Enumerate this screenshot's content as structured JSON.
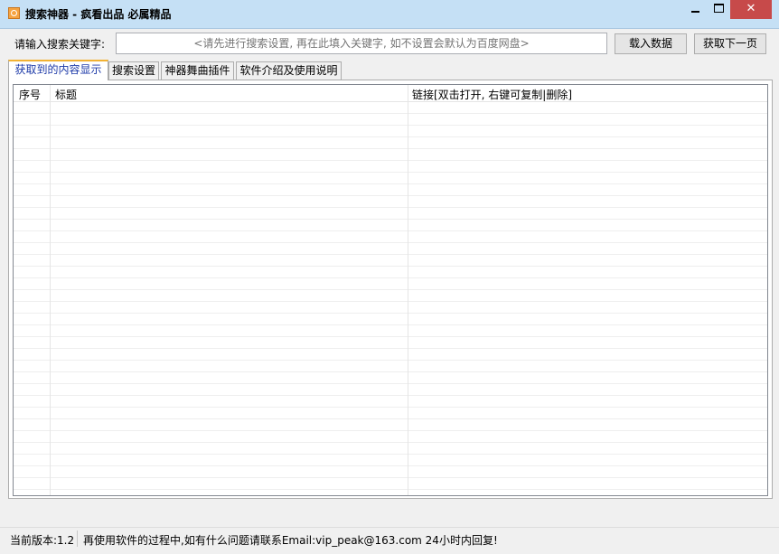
{
  "window": {
    "title": "搜索神器 - 疯看出品 必属精品",
    "icon": "app-icon",
    "controls": {
      "minimize": "minimize-icon",
      "maximize": "maximize-icon",
      "close": "✕"
    }
  },
  "search": {
    "label": "请输入搜索关键字:",
    "placeholder": "<请先进行搜索设置, 再在此填入关键字, 如不设置会默认为百度网盘>",
    "value": ""
  },
  "buttons": {
    "load": "载入数据",
    "next_page": "获取下一页"
  },
  "tabs": [
    {
      "label": "获取到的内容显示",
      "active": true
    },
    {
      "label": "搜索设置",
      "active": false
    },
    {
      "label": "神器舞曲插件",
      "active": false
    },
    {
      "label": "软件介绍及使用说明",
      "active": false
    }
  ],
  "table": {
    "columns": [
      "序号",
      "标题",
      "链接[双击打开, 右键可复制|删除]"
    ],
    "rows": []
  },
  "status": {
    "version": "当前版本:1.2",
    "message": "再使用软件的过程中,如有什么问题请联系Email:vip_peak@163.com 24小时内回复!"
  },
  "colors": {
    "title_bar": "#c5e0f5",
    "close_button": "#c74a4a",
    "active_tab_accent": "#f2b233",
    "hint_text": "#1d3aa8"
  }
}
